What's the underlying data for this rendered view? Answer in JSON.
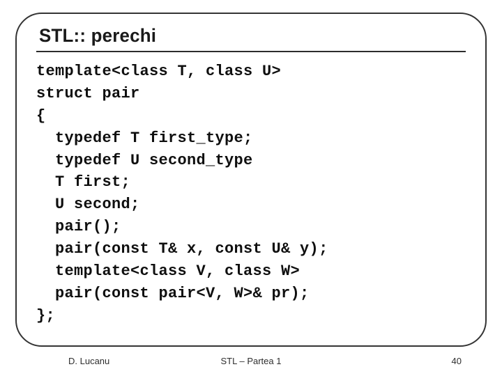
{
  "slide": {
    "title": "STL:: perechi",
    "code": "template<class T, class U>\nstruct pair\n{\n  typedef T first_type;\n  typedef U second_type\n  T first;\n  U second;\n  pair();\n  pair(const T& x, const U& y);\n  template<class V, class W>\n  pair(const pair<V, W>& pr);\n};"
  },
  "footer": {
    "left": "D. Lucanu",
    "center": "STL – Partea 1",
    "right": "40"
  }
}
